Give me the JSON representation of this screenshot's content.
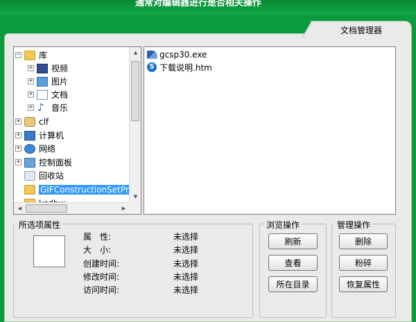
{
  "header": {
    "text": "通常对编辑器进行是否相关操作"
  },
  "tab": {
    "label": "文档管理器"
  },
  "tree": {
    "items": [
      {
        "label": "库",
        "expander": "−",
        "icon": "folder"
      },
      {
        "label": "视频",
        "expander": "+",
        "icon": "video"
      },
      {
        "label": "图片",
        "expander": "+",
        "icon": "image"
      },
      {
        "label": "文档",
        "expander": "+",
        "icon": "doc"
      },
      {
        "label": "音乐",
        "expander": "+",
        "icon": "music"
      },
      {
        "label": "clf",
        "expander": "+",
        "icon": "user"
      },
      {
        "label": "计算机",
        "expander": "+",
        "icon": "pc"
      },
      {
        "label": "网络",
        "expander": "+",
        "icon": "net"
      },
      {
        "label": "控制面板",
        "expander": "+",
        "icon": "panel"
      },
      {
        "label": "回收站",
        "expander": "",
        "icon": "bin"
      },
      {
        "label": "GIFConstructionSetPro",
        "expander": "",
        "icon": "folder"
      },
      {
        "label": "ksdbw",
        "expander": "",
        "icon": "folder"
      }
    ]
  },
  "files": [
    {
      "name": "gcsp30.exe",
      "icon": "exe-icon"
    },
    {
      "name": "下载说明.htm",
      "icon": "htm-icon"
    }
  ],
  "properties": {
    "title": "所选项属性",
    "rows": [
      {
        "label": "属　性:",
        "value": "未选择"
      },
      {
        "label": "大　小:",
        "value": "未选择"
      },
      {
        "label": "创建时间:",
        "value": "未选择"
      },
      {
        "label": "修改时间:",
        "value": "未选择"
      },
      {
        "label": "访问时间:",
        "value": "未选择"
      }
    ]
  },
  "browse": {
    "title": "浏览操作",
    "buttons": [
      "刷新",
      "查看",
      "所在目录"
    ]
  },
  "manage": {
    "title": "管理操作",
    "buttons": [
      "删除",
      "粉碎",
      "恢复属性"
    ]
  }
}
